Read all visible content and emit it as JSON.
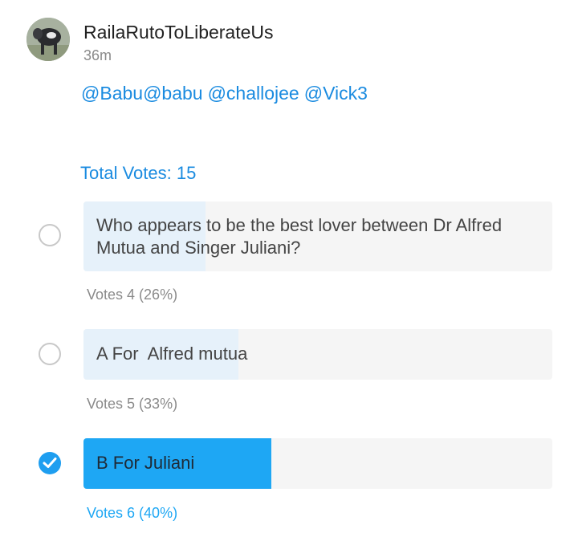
{
  "post": {
    "username": "RailaRutoToLiberateUs",
    "time": "36m",
    "avatar_icon": "user-avatar",
    "mentions": [
      "@Babu@babu",
      "@challojee",
      "@Vick3"
    ]
  },
  "poll": {
    "total_votes_label": "Total Votes: 15",
    "accent_color": "#1ea7f4",
    "options": [
      {
        "text": "Who appears to be the best lover between Dr Alfred Mutua and Singer Juliani?",
        "votes_label": "Votes 4 (26%)",
        "percent": 26,
        "selected": false
      },
      {
        "text": "A For  Alfred mutua",
        "votes_label": "Votes 5 (33%)",
        "percent": 33,
        "selected": false
      },
      {
        "text": "B For Juliani",
        "votes_label": "Votes 6 (40%)",
        "percent": 40,
        "selected": true
      }
    ]
  }
}
